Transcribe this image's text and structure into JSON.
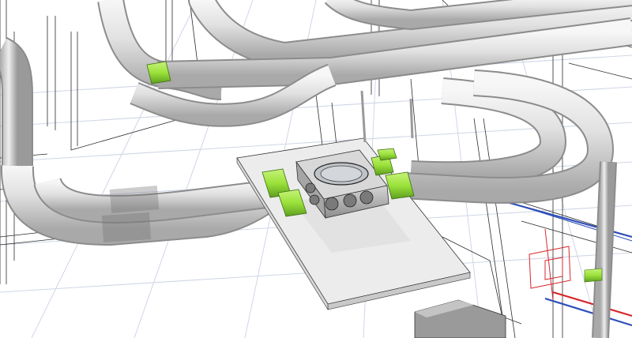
{
  "scene": {
    "kind": "3d-bim-render",
    "subject": "ventilation-ducts-and-distribution-box",
    "colors": {
      "background": "#ffffff",
      "floor_grid": "#cfd6e6",
      "wireframe": "#2b2b2b",
      "duct_light": "#e6e6e6",
      "duct_mid": "#bdbdbd",
      "duct_shadow": "#8c8c8c",
      "fitting_green": "#9be23a",
      "fitting_green_dark": "#5e9e1f",
      "plenum_box": "#b9b9b9",
      "plenum_panel": "#ececec",
      "pipe_red": "#d8262b",
      "pipe_blue": "#2f4fb8"
    },
    "elements": {
      "distribution_box": "plenum-distribution-box",
      "fittings": "green-duct-connectors",
      "ceiling_panel": "ceiling-diffuser-panel",
      "ducts": "round-flexible-ducts",
      "pipes": "heating-pipes-red-blue",
      "grid": "perspective-floor-grid"
    }
  }
}
